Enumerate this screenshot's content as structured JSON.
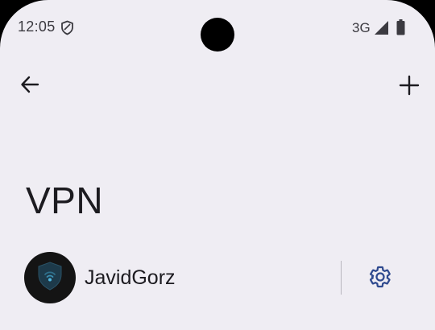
{
  "status_bar": {
    "time": "12:05",
    "network_type": "3G",
    "icons": [
      "shield-icon",
      "signal-icon",
      "battery-icon"
    ]
  },
  "toolbar": {
    "back_icon": "arrow-left-icon",
    "add_icon": "plus-icon"
  },
  "page": {
    "title": "VPN"
  },
  "vpn_list": {
    "items": [
      {
        "name": "JavidGorz",
        "avatar_icon": "vpn-shield-icon",
        "settings_icon": "gear-icon"
      }
    ]
  },
  "colors": {
    "background": "#efedf3",
    "text_primary": "#1c1b20",
    "icon_accent": "#2f4a8f",
    "avatar_background": "#141414",
    "avatar_shield": "#1d3a4a"
  }
}
